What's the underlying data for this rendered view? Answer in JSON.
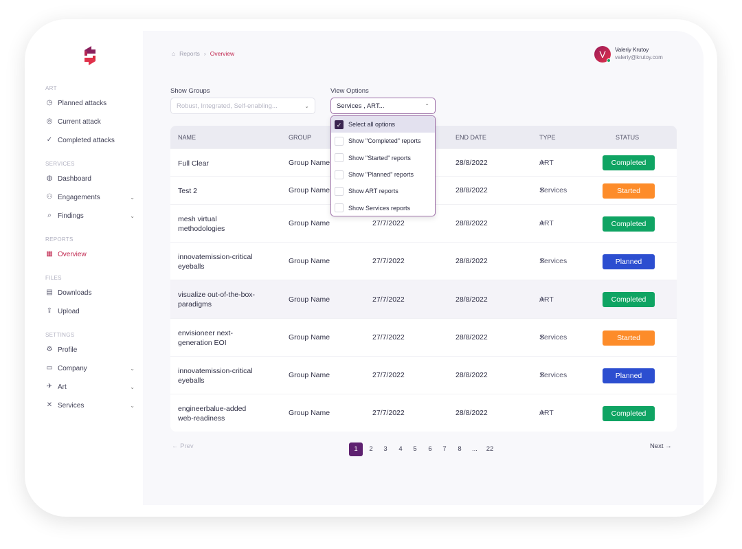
{
  "brand": {
    "accent": "#c0264e",
    "primary": "#5e2170"
  },
  "sidebar": {
    "sections": [
      {
        "title": "ART",
        "items": [
          {
            "label": "Planned attacks",
            "icon": "clock-list-icon"
          },
          {
            "label": "Current attack",
            "icon": "target-icon"
          },
          {
            "label": "Completed attacks",
            "icon": "check-circle-icon"
          }
        ]
      },
      {
        "title": "SERVICES",
        "items": [
          {
            "label": "Dashboard",
            "icon": "globe-icon"
          },
          {
            "label": "Engagements",
            "icon": "people-icon",
            "expandable": true
          },
          {
            "label": "Findings",
            "icon": "clipboard-search-icon",
            "expandable": true
          }
        ]
      },
      {
        "title": "REPORTS",
        "items": [
          {
            "label": "Overview",
            "icon": "table-icon",
            "active": true
          }
        ]
      },
      {
        "title": "FILES",
        "items": [
          {
            "label": "Downloads",
            "icon": "file-icon"
          },
          {
            "label": "Upload",
            "icon": "file-upload-icon"
          }
        ]
      },
      {
        "title": "SETTINGS",
        "items": [
          {
            "label": "Profile",
            "icon": "user-gear-icon"
          },
          {
            "label": "Company",
            "icon": "briefcase-icon",
            "expandable": true
          },
          {
            "label": "Art",
            "icon": "rocket-icon",
            "expandable": true
          },
          {
            "label": "Services",
            "icon": "tools-icon",
            "expandable": true
          }
        ]
      }
    ]
  },
  "breadcrumb": {
    "parent": "Reports",
    "current": "Overview"
  },
  "user": {
    "initial": "V",
    "name": "Valeriy Krutoy",
    "email": "valeriy@krutoy.com"
  },
  "filters": {
    "groups_label": "Show Groups",
    "groups_placeholder": "Robust, Integrated, Self-enabling...",
    "view_label": "View Options",
    "view_value": "Services , ART..."
  },
  "dropdown": {
    "options": [
      {
        "label": "Select all options",
        "checked": true
      },
      {
        "label": "Show \"Completed\" reports",
        "checked": false
      },
      {
        "label": "Show \"Started\" reports",
        "checked": false
      },
      {
        "label": "Show \"Planned\" reports",
        "checked": false
      },
      {
        "label": "Show ART reports",
        "checked": false
      },
      {
        "label": "Show Services reports",
        "checked": false
      }
    ]
  },
  "table": {
    "headers": {
      "name": "NAME",
      "group": "GROUP",
      "end": "END DATE",
      "type": "TYPE",
      "status": "STATUS"
    },
    "rows": [
      {
        "name": "Full Clear",
        "group": "Group Name",
        "start": "",
        "end": "28/8/2022",
        "type": "ART",
        "status": "Completed"
      },
      {
        "name": "Test 2",
        "group": "Group Name",
        "start": "",
        "end": "28/8/2022",
        "type": "Services",
        "status": "Started"
      },
      {
        "name": "mesh virtual methodologies",
        "group": "Group Name",
        "start": "27/7/2022",
        "end": "28/8/2022",
        "type": "ART",
        "status": "Completed"
      },
      {
        "name": "innovatemission-critical eyeballs",
        "group": "Group Name",
        "start": "27/7/2022",
        "end": "28/8/2022",
        "type": "Services",
        "status": "Planned"
      },
      {
        "name": "visualize out-of-the-box-paradigms",
        "group": "Group Name",
        "start": "27/7/2022",
        "end": "28/8/2022",
        "type": "ART",
        "status": "Completed"
      },
      {
        "name": "envisioneer next-generation EOI",
        "group": "Group Name",
        "start": "27/7/2022",
        "end": "28/8/2022",
        "type": "Services",
        "status": "Started"
      },
      {
        "name": "innovatemission-critical eyeballs",
        "group": "Group Name",
        "start": "27/7/2022",
        "end": "28/8/2022",
        "type": "Services",
        "status": "Planned"
      },
      {
        "name": "engineerbalue-added web-readiness",
        "group": "Group Name",
        "start": "27/7/2022",
        "end": "28/8/2022",
        "type": "ART",
        "status": "Completed"
      }
    ]
  },
  "status_colors": {
    "Completed": "#0fa463",
    "Started": "#fd8c2a",
    "Planned": "#2c4ed0"
  },
  "pagination": {
    "prev": "Prev",
    "next": "Next",
    "pages": [
      "1",
      "2",
      "3",
      "4",
      "5",
      "6",
      "7",
      "8",
      "...",
      "22"
    ],
    "current": "1"
  }
}
